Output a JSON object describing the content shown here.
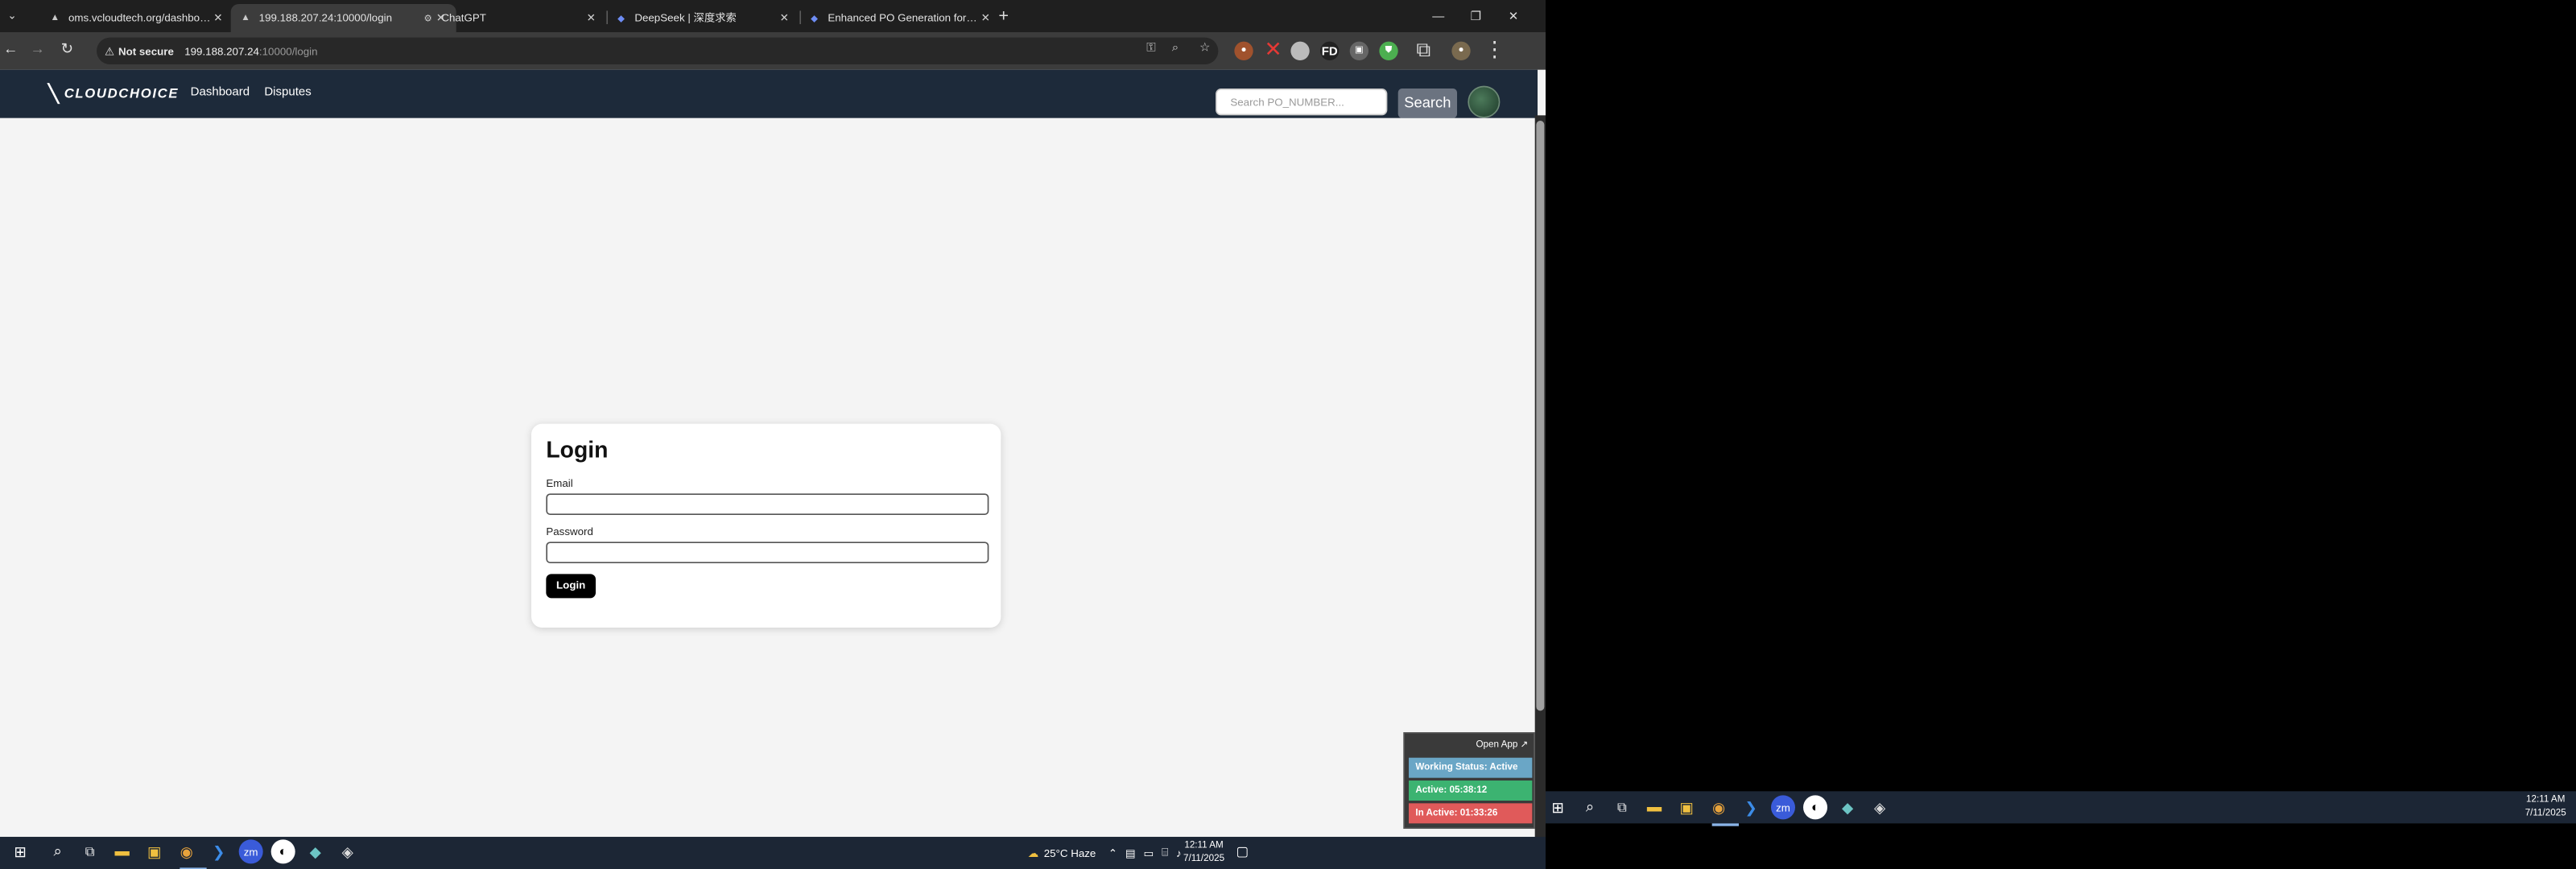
{
  "browser": {
    "tabs": [
      {
        "title": "oms.vcloudtech.org/dashboard",
        "favicon": "triangle-icon"
      },
      {
        "title": "199.188.207.24:10000/login",
        "favicon": "triangle-icon"
      },
      {
        "title": "ChatGPT",
        "favicon": "chatgpt-icon"
      },
      {
        "title": "DeepSeek | 深度求索",
        "favicon": "deepseek-icon"
      },
      {
        "title": "Enhanced PO Generation for M",
        "favicon": "deepseek-icon"
      }
    ],
    "active_tab": 1,
    "address": {
      "security_label": "Not secure",
      "host": "199.188.207.24",
      "path": ":10000/login"
    }
  },
  "app": {
    "logo_text": "CLOUDCHOICE",
    "nav": {
      "dashboard": "Dashboard",
      "disputes": "Disputes"
    },
    "search": {
      "placeholder": "Search PO_NUMBER...",
      "button": "Search"
    }
  },
  "login": {
    "title": "Login",
    "email_label": "Email",
    "email_value": "",
    "password_label": "Password",
    "password_value": "",
    "submit": "Login"
  },
  "widget": {
    "open_app": "Open App ↗",
    "working_status": "Working Status: Active",
    "active": "Active: 05:38:12",
    "inactive": "In Active: 01:33:26"
  },
  "taskbar": {
    "weather": "25°C  Haze",
    "time": "12:11 AM",
    "date": "7/11/2025"
  },
  "taskbar2": {
    "time": "12:11 AM",
    "date": "7/11/2025"
  },
  "colors": {
    "nav_bg": "#1d2a3a",
    "page_bg": "#f4f4f4",
    "status_blue": "#6aa6c6",
    "status_green": "#3cb371",
    "status_red": "#e05a5a"
  }
}
